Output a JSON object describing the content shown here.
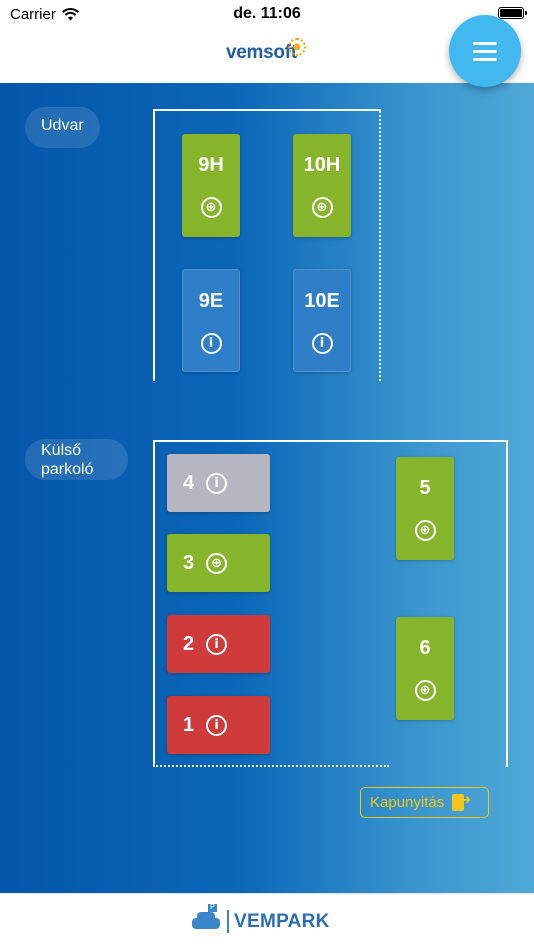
{
  "status_bar": {
    "carrier": "Carrier",
    "time": "de. 11:06"
  },
  "header": {
    "logo": "vemsoft"
  },
  "zones": [
    {
      "label": "Udvar"
    },
    {
      "label": "Külső parkoló"
    }
  ],
  "spots": {
    "s9h": {
      "label": "9H",
      "status": "free",
      "action": "add"
    },
    "s10h": {
      "label": "10H",
      "status": "free",
      "action": "add"
    },
    "s9e": {
      "label": "9E",
      "status": "reserved",
      "action": "info"
    },
    "s10e": {
      "label": "10E",
      "status": "reserved",
      "action": "info"
    },
    "s4": {
      "label": "4",
      "status": "unavailable",
      "action": "info"
    },
    "s3": {
      "label": "3",
      "status": "free",
      "action": "add"
    },
    "s2": {
      "label": "2",
      "status": "occupied",
      "action": "info"
    },
    "s1": {
      "label": "1",
      "status": "occupied",
      "action": "info"
    },
    "s5": {
      "label": "5",
      "status": "free",
      "action": "add"
    },
    "s6": {
      "label": "6",
      "status": "free",
      "action": "add"
    }
  },
  "icons": {
    "add": "⊕",
    "info": "i"
  },
  "gate_button": {
    "label": "Kapunyitás"
  },
  "footer": {
    "brand": "VEMPARK"
  },
  "colors": {
    "free": "#86b52b",
    "occupied": "#cf3a3a",
    "unavailable": "#b6b6c2",
    "reserved": "#2f7ec8",
    "accent": "#42b8f0",
    "gate": "#f5c518"
  }
}
